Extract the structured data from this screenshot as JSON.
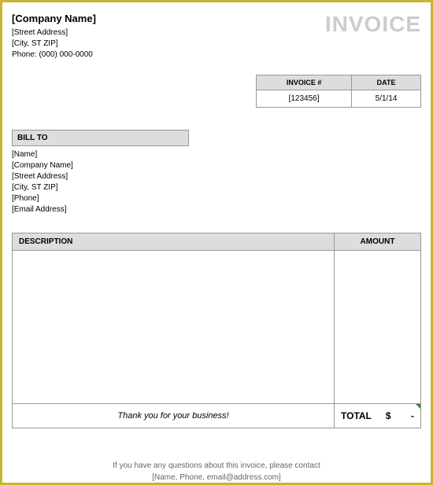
{
  "header": {
    "company_name": "[Company Name]",
    "street": "[Street Address]",
    "city_st_zip": "[City, ST  ZIP]",
    "phone": "Phone: (000) 000-0000",
    "invoice_title": "INVOICE"
  },
  "meta": {
    "invoice_num_label": "INVOICE #",
    "date_label": "DATE",
    "invoice_num": "[123456]",
    "date": "5/1/14"
  },
  "billto": {
    "label": "BILL TO",
    "name": "[Name]",
    "company": "[Company Name]",
    "street": "[Street Address]",
    "city_st_zip": "[City, ST  ZIP]",
    "phone": "[Phone]",
    "email": "[Email Address]"
  },
  "table": {
    "desc_label": "DESCRIPTION",
    "amount_label": "AMOUNT"
  },
  "thanks": "Thank you for your business!",
  "total": {
    "label": "TOTAL",
    "currency": "$",
    "value": "-"
  },
  "footer": {
    "line1": "If you have any questions about this invoice, please contact",
    "line2": "[Name, Phone, email@address.com]"
  }
}
